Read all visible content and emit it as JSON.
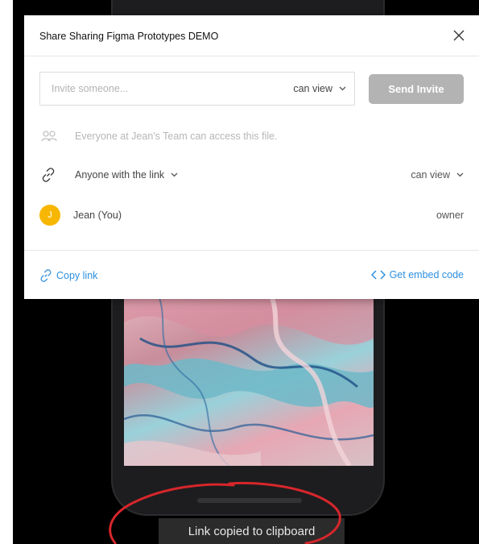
{
  "dialog": {
    "title": "Share Sharing Figma Prototypes DEMO"
  },
  "invite": {
    "placeholder": "Invite someone...",
    "permission": "can view",
    "send_label": "Send Invite"
  },
  "team_access": {
    "text": "Everyone at Jean's Team can access this file."
  },
  "link_access": {
    "scope": "Anyone with the link",
    "permission": "can view"
  },
  "owner": {
    "initial": "J",
    "name": "Jean (You)",
    "role": "owner"
  },
  "footer": {
    "copy_link": "Copy link",
    "embed_code": "Get embed code"
  },
  "toast": {
    "text": "Link copied to clipboard"
  },
  "colors": {
    "accent_link": "#2d8fe0",
    "avatar": "#f7b600",
    "send_button": "#b3b3b3",
    "annotation": "#d6262b"
  },
  "icons": {
    "close": "close-icon",
    "chevron": "chevron-down-icon",
    "team": "team-icon",
    "link": "link-icon",
    "code": "code-icon"
  }
}
